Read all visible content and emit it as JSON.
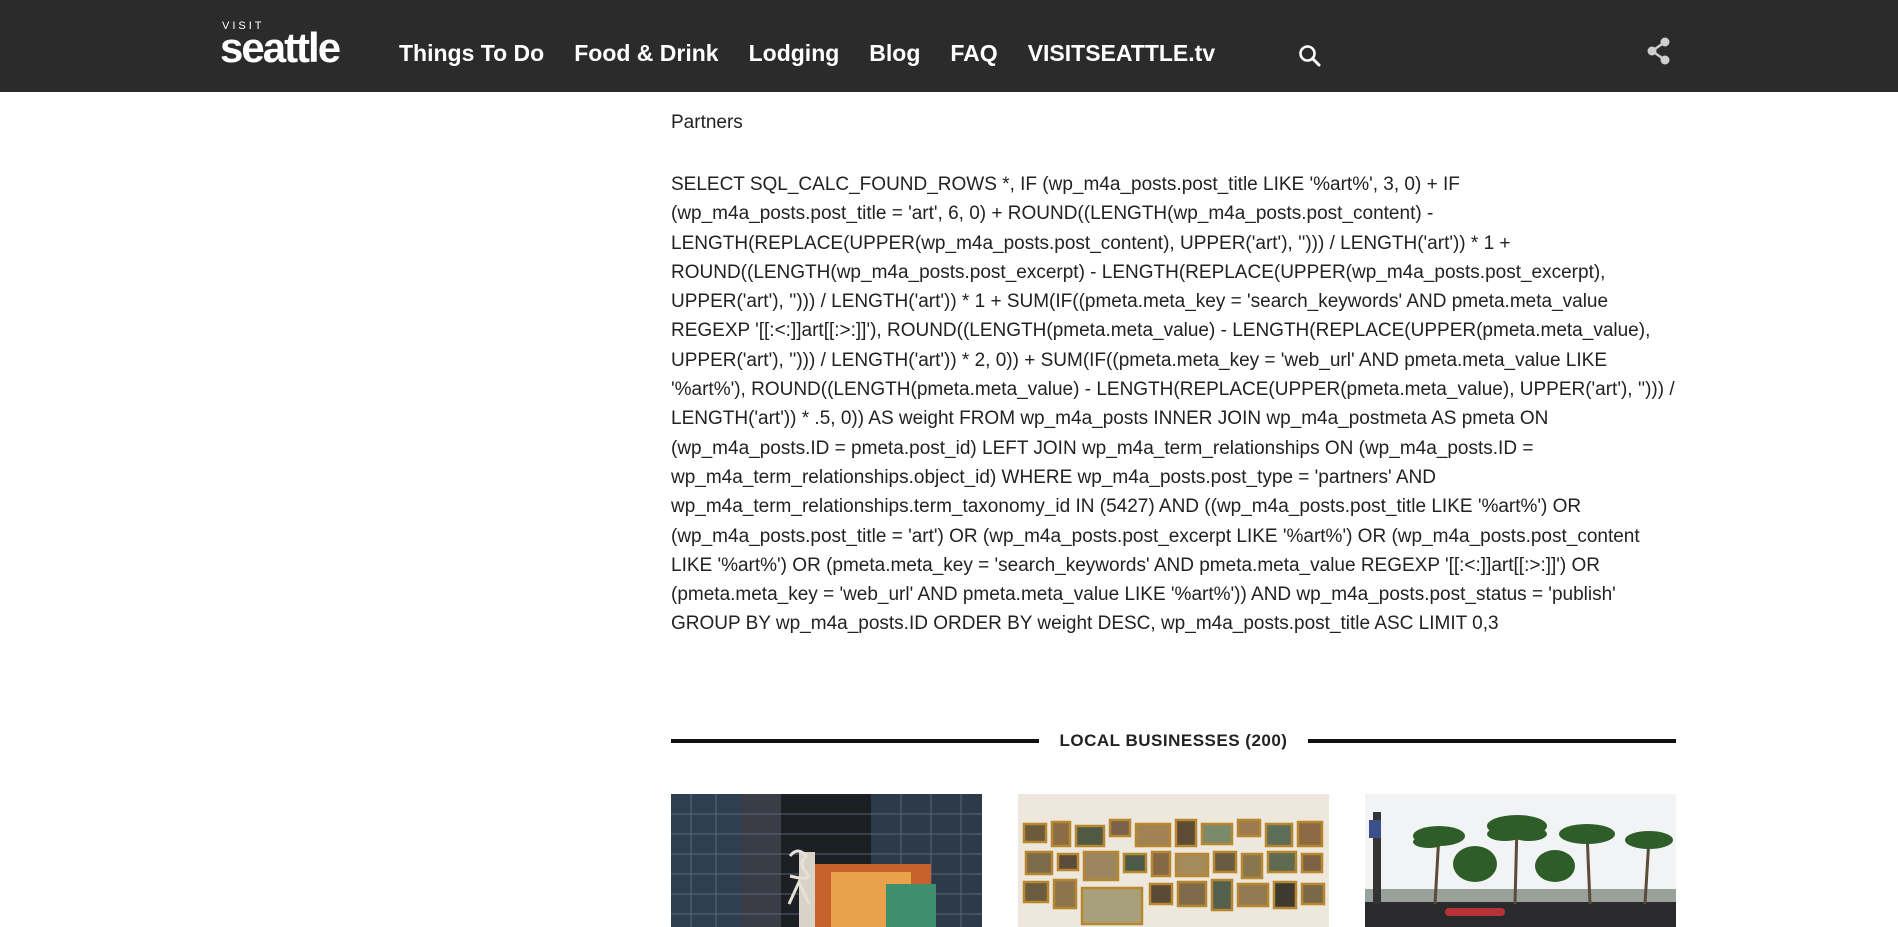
{
  "header": {
    "logo_small": "VISIT",
    "logo_big": "seattle",
    "nav": [
      {
        "label": "Things To Do"
      },
      {
        "label": "Food & Drink"
      },
      {
        "label": "Lodging"
      },
      {
        "label": "Blog"
      },
      {
        "label": "FAQ"
      },
      {
        "label": "VISITSEATTLE.tv"
      }
    ],
    "search_icon": "search-icon",
    "share_icon": "share-icon"
  },
  "main": {
    "heading": "Partners",
    "sql_text": "SELECT SQL_CALC_FOUND_ROWS *, IF (wp_m4a_posts.post_title LIKE '%art%', 3, 0) + IF (wp_m4a_posts.post_title = 'art', 6, 0) + ROUND((LENGTH(wp_m4a_posts.post_content) - LENGTH(REPLACE(UPPER(wp_m4a_posts.post_content), UPPER('art'), ''))) / LENGTH('art')) * 1 + ROUND((LENGTH(wp_m4a_posts.post_excerpt) - LENGTH(REPLACE(UPPER(wp_m4a_posts.post_excerpt), UPPER('art'), ''))) / LENGTH('art')) * 1 + SUM(IF((pmeta.meta_key = 'search_keywords' AND pmeta.meta_value REGEXP '[[:<:]]art[[:>:]]'), ROUND((LENGTH(pmeta.meta_value) - LENGTH(REPLACE(UPPER(pmeta.meta_value), UPPER('art'), ''))) / LENGTH('art')) * 2, 0)) + SUM(IF((pmeta.meta_key = 'web_url' AND pmeta.meta_value LIKE '%art%'), ROUND((LENGTH(pmeta.meta_value) - LENGTH(REPLACE(UPPER(pmeta.meta_value), UPPER('art'), ''))) / LENGTH('art')) * .5, 0)) AS weight FROM wp_m4a_posts INNER JOIN wp_m4a_postmeta AS pmeta ON (wp_m4a_posts.ID = pmeta.post_id) LEFT JOIN wp_m4a_term_relationships ON (wp_m4a_posts.ID = wp_m4a_term_relationships.object_id) WHERE wp_m4a_posts.post_type = 'partners' AND wp_m4a_term_relationships.term_taxonomy_id IN (5427) AND ((wp_m4a_posts.post_title LIKE '%art%') OR (wp_m4a_posts.post_title = 'art') OR (wp_m4a_posts.post_excerpt LIKE '%art%') OR (wp_m4a_posts.post_content LIKE '%art%') OR (pmeta.meta_key = 'search_keywords' AND pmeta.meta_value REGEXP '[[:<:]]art[[:>:]]') OR (pmeta.meta_key = 'web_url' AND pmeta.meta_value LIKE '%art%')) AND wp_m4a_posts.post_status = 'publish' GROUP BY wp_m4a_posts.ID ORDER BY weight DESC, wp_m4a_posts.post_title ASC LIMIT 0,3",
    "section_title": "LOCAL BUSINESSES (200)"
  },
  "colors": {
    "header_bg": "#2b2b2b",
    "header_text": "#ffffff",
    "body_text": "#222222",
    "divider": "#111111"
  }
}
